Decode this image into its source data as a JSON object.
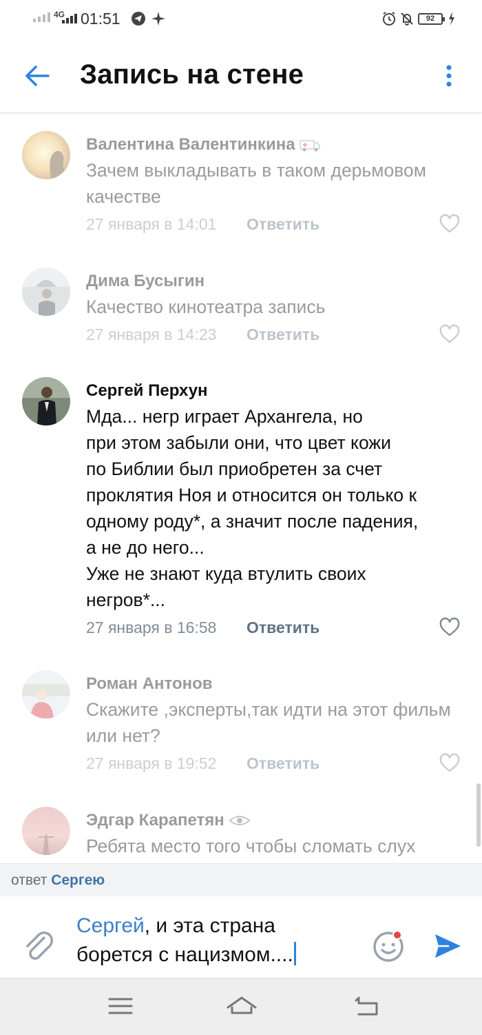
{
  "status_bar": {
    "network": "4G",
    "time": "01:51",
    "battery": "92"
  },
  "header": {
    "title": "Запись на стене"
  },
  "comments": [
    {
      "author": "Валентина Валентинкина",
      "badge_icon": "ambulance-icon",
      "text": "Зачем выкладывать в таком дерьмовом качестве",
      "date": "27 января в 14:01",
      "reply": "Ответить",
      "faded": true
    },
    {
      "author": "Дима Бусыгин",
      "text": "Качество кинотеатра запись",
      "date": "27 января в 14:23",
      "reply": "Ответить",
      "faded": true
    },
    {
      "author": "Сергей Перхун",
      "text_lines": [
        "Мда... негр играет Архангела, но",
        "при этом забыли они, что цвет кожи",
        "по Библии был приобретен за счет",
        "проклятия Ноя и относится он только к",
        "одному роду*, а значит после падения,",
        "а не до него...",
        "Уже не знают куда втулить своих",
        "негров*..."
      ],
      "date": "27 января в 16:58",
      "reply": "Ответить",
      "faded": false
    },
    {
      "author": "Роман Антонов",
      "text": "Скажите ,эксперты,так идти на этот фильм или нет?",
      "date": "27 января в 19:52",
      "reply": "Ответить",
      "faded": true
    },
    {
      "author": "Эдгар Карапетян",
      "badge_icon": "eye-icon",
      "text": "Ребята место того чтобы сломать слух",
      "faded": true
    }
  ],
  "reply_bar": {
    "prefix": "ответ",
    "name": "Сергею"
  },
  "composer": {
    "mention": "Сергей",
    "text_line1": ", и эта страна",
    "text_line2": "борется с нацизмом...."
  },
  "colors": {
    "accent": "#2d81e0",
    "meta": "#818c99",
    "reply": "#5f7285"
  }
}
